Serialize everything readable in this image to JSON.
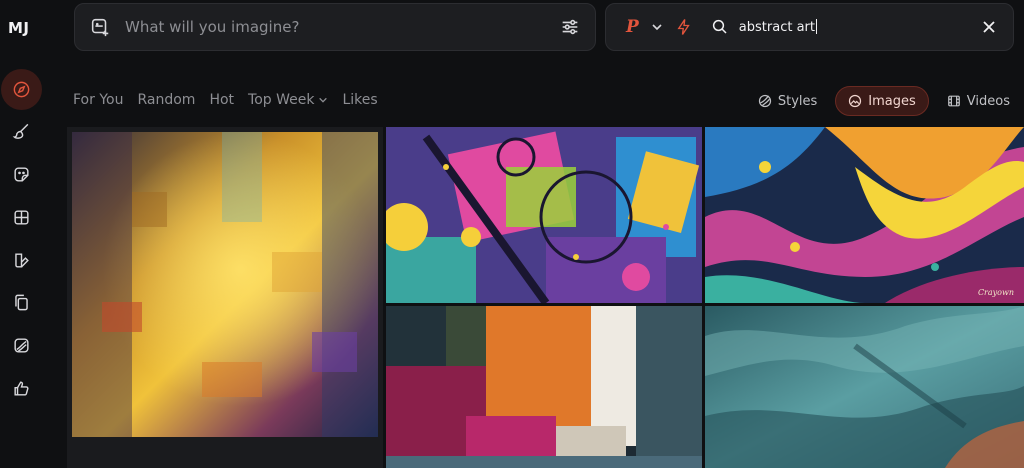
{
  "app": {
    "logo": "MJ"
  },
  "prompt": {
    "placeholder": "What will you imagine?"
  },
  "search": {
    "badge": "P",
    "query": "abstract art"
  },
  "filters": {
    "items": [
      {
        "label": "For You"
      },
      {
        "label": "Random"
      },
      {
        "label": "Hot"
      },
      {
        "label": "Top Week"
      },
      {
        "label": "Likes"
      }
    ]
  },
  "views": {
    "styles": "Styles",
    "images": "Images",
    "videos": "Videos",
    "selected": "Images"
  },
  "colors": {
    "accent": "#e2553d",
    "background": "#0f1012",
    "panel": "#1d1e21"
  },
  "sidebar": {
    "items": [
      {
        "icon": "compass-icon",
        "active": true
      },
      {
        "icon": "brush-icon"
      },
      {
        "icon": "sticker-icon"
      },
      {
        "icon": "grid-icon"
      },
      {
        "icon": "edit-icon"
      },
      {
        "icon": "copy-icon"
      },
      {
        "icon": "texture-icon"
      },
      {
        "icon": "thumbs-up-icon"
      }
    ]
  },
  "gallery": {
    "images": [
      {
        "name": "impasto-gold-abstract"
      },
      {
        "name": "geometric-color-shapes"
      },
      {
        "name": "fluid-color-swirl",
        "signature": "Crayown"
      },
      {
        "name": "brush-stroke-blocks"
      },
      {
        "name": "teal-textured-abstract"
      }
    ]
  }
}
